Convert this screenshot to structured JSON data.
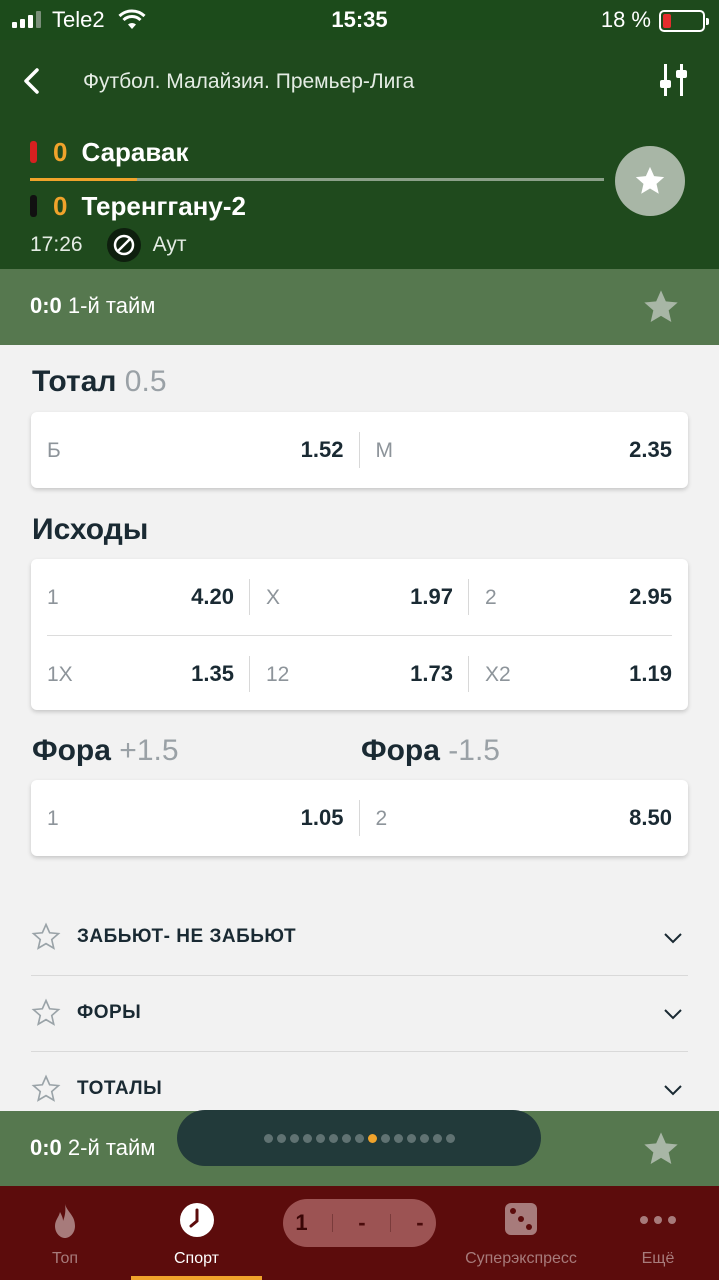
{
  "status_bar": {
    "carrier": "Tele2",
    "time": "15:35",
    "battery": "18 %"
  },
  "header": {
    "breadcrumb": "Футбол. Малайзия. Премьер-Лига",
    "team1": {
      "score": "0",
      "name": "Саравак",
      "color": "#d62020"
    },
    "team2": {
      "score": "0",
      "name": "Теренггану-2",
      "color": "#111111"
    },
    "match_time": "17:26",
    "event": "Аут"
  },
  "half1": {
    "score": "0:0",
    "label": "1-й тайм"
  },
  "half2": {
    "score": "0:0",
    "label": "2-й тайм"
  },
  "total": {
    "title": "Тотал",
    "value": "0.5",
    "cells": [
      {
        "name": "Б",
        "odd": "1.52"
      },
      {
        "name": "М",
        "odd": "2.35"
      }
    ]
  },
  "outcomes": {
    "title": "Исходы",
    "row1": [
      {
        "name": "1",
        "odd": "4.20"
      },
      {
        "name": "X",
        "odd": "1.97"
      },
      {
        "name": "2",
        "odd": "2.95"
      }
    ],
    "row2": [
      {
        "name": "1X",
        "odd": "1.35"
      },
      {
        "name": "12",
        "odd": "1.73"
      },
      {
        "name": "X2",
        "odd": "1.19"
      }
    ]
  },
  "handicap": {
    "title1": "Фора",
    "value1": "+1.5",
    "title2": "Фора",
    "value2": "-1.5",
    "cells": [
      {
        "name": "1",
        "odd": "1.05"
      },
      {
        "name": "2",
        "odd": "8.50"
      }
    ]
  },
  "accordion": [
    {
      "label": "ЗАБЬЮТ- НЕ ЗАБЬЮТ"
    },
    {
      "label": "ФОРЫ"
    },
    {
      "label": "ТОТАЛЫ"
    }
  ],
  "pager": {
    "total": 15,
    "active": 8
  },
  "tabs": {
    "top": "Топ",
    "sport": "Спорт",
    "coupon": [
      "1",
      "-",
      "-"
    ],
    "super": "Суперэкспресс",
    "more": "Ещё"
  },
  "colors": {
    "header": "#1f4a1d",
    "half_bar": "#56784f",
    "accent": "#f0a32b",
    "tab_bar": "#5c0c0c"
  }
}
